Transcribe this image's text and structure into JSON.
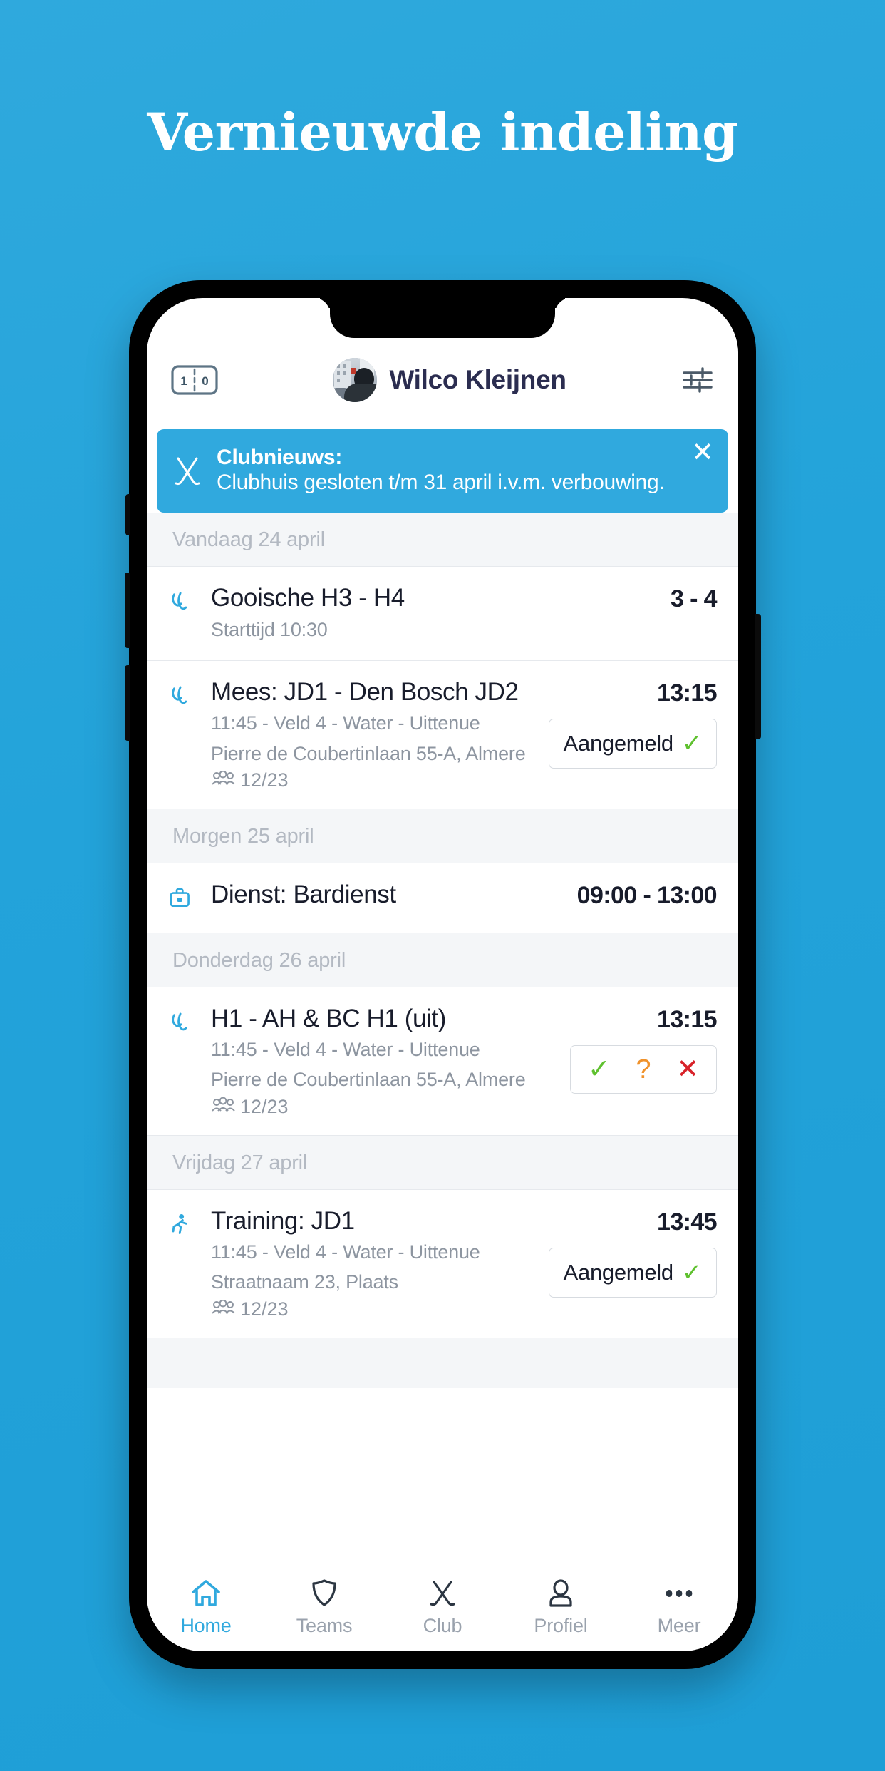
{
  "page": {
    "headline": "Vernieuwde indeling",
    "background_color": "#23a3da"
  },
  "app": {
    "header": {
      "score_icon": "scoreboard-icon",
      "score_left": "1",
      "score_right": "0",
      "avatar": "user-avatar",
      "user_name": "Wilco Kleijnen",
      "filter_icon": "sliders-icon"
    },
    "banner": {
      "icon": "crossed-hockey-sticks-icon",
      "title": "Clubnieuws:",
      "message": "Clubhuis gesloten t/m 31 april i.v.m. verbouwing.",
      "close_label": "✕",
      "color": "#30a9de"
    },
    "feed": [
      {
        "day": "Vandaag 24 april",
        "items": [
          {
            "icon": "hockey-sticks-icon",
            "title": "Gooische H3 - H4",
            "lines": [
              "Starttijd 10:30"
            ],
            "attendance": null,
            "time": "3 - 4",
            "action": null
          },
          {
            "icon": "hockey-sticks-icon",
            "title": "Mees: JD1 - Den Bosch JD2",
            "lines": [
              "11:45 - Veld 4 - Water - Uittenue",
              "Pierre de Coubertinlaan 55-A, Almere"
            ],
            "attendance": "12/23",
            "time": "13:15",
            "action": {
              "type": "registered",
              "label": "Aangemeld",
              "check": "✓"
            }
          }
        ]
      },
      {
        "day": "Morgen 25 april",
        "items": [
          {
            "icon": "briefcase-icon",
            "title": "Dienst: Bardienst",
            "lines": [],
            "attendance": null,
            "time": "09:00 - 13:00",
            "action": null
          }
        ]
      },
      {
        "day": "Donderdag 26 april",
        "items": [
          {
            "icon": "hockey-sticks-icon",
            "title": "H1 - AH & BC H1 (uit)",
            "lines": [
              "11:45 - Veld 4 - Water - Uittenue",
              "Pierre de Coubertinlaan 55-A, Almere"
            ],
            "attendance": "12/23",
            "time": "13:15",
            "action": {
              "type": "choice",
              "yes": "✓",
              "maybe": "?",
              "no": "✕"
            }
          }
        ]
      },
      {
        "day": "Vrijdag 27 april",
        "items": [
          {
            "icon": "running-person-icon",
            "title": "Training: JD1",
            "lines": [
              "11:45 - Veld 4 - Water - Uittenue",
              "Straatnaam 23, Plaats"
            ],
            "attendance": "12/23",
            "time": "13:45",
            "action": {
              "type": "registered",
              "label": "Aangemeld",
              "check": "✓"
            }
          }
        ]
      }
    ],
    "tabbar": {
      "active_index": 0,
      "accent_color": "#30a9de",
      "items": [
        {
          "icon": "home-icon",
          "label": "Home"
        },
        {
          "icon": "shield-icon",
          "label": "Teams"
        },
        {
          "icon": "crossed-hockey-sticks-icon",
          "label": "Club"
        },
        {
          "icon": "person-icon",
          "label": "Profiel"
        },
        {
          "icon": "ellipsis-icon",
          "label": "Meer"
        }
      ]
    }
  }
}
